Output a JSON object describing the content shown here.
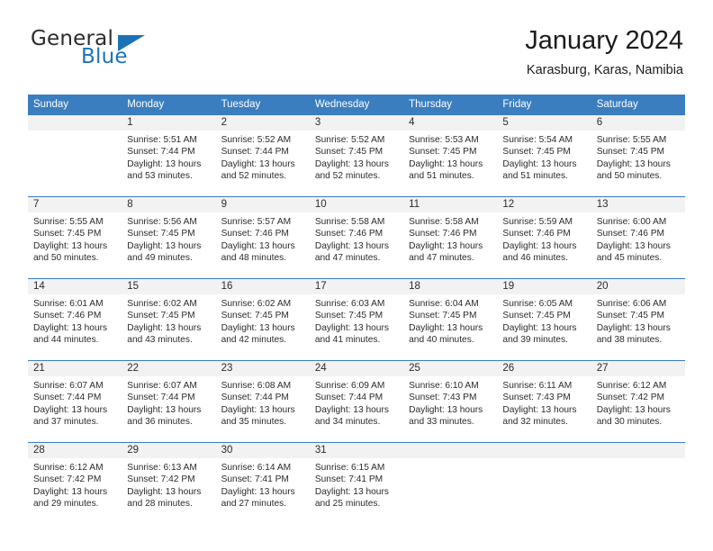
{
  "brand": {
    "name_part1": "General",
    "name_part2": "Blue",
    "triangle_color": "#1b72b8"
  },
  "header": {
    "title": "January 2024",
    "subtitle": "Karasburg, Karas, Namibia"
  },
  "theme": {
    "header_row_bg": "#3a7ebf",
    "daynum_bg": "#f2f2f2",
    "text": "#2b2b2b"
  },
  "weekday_headers": [
    "Sunday",
    "Monday",
    "Tuesday",
    "Wednesday",
    "Thursday",
    "Friday",
    "Saturday"
  ],
  "weeks": [
    [
      {
        "day": "",
        "sunrise": "",
        "sunset": "",
        "daylight_l1": "",
        "daylight_l2": ""
      },
      {
        "day": "1",
        "sunrise": "Sunrise: 5:51 AM",
        "sunset": "Sunset: 7:44 PM",
        "daylight_l1": "Daylight: 13 hours",
        "daylight_l2": "and 53 minutes."
      },
      {
        "day": "2",
        "sunrise": "Sunrise: 5:52 AM",
        "sunset": "Sunset: 7:44 PM",
        "daylight_l1": "Daylight: 13 hours",
        "daylight_l2": "and 52 minutes."
      },
      {
        "day": "3",
        "sunrise": "Sunrise: 5:52 AM",
        "sunset": "Sunset: 7:45 PM",
        "daylight_l1": "Daylight: 13 hours",
        "daylight_l2": "and 52 minutes."
      },
      {
        "day": "4",
        "sunrise": "Sunrise: 5:53 AM",
        "sunset": "Sunset: 7:45 PM",
        "daylight_l1": "Daylight: 13 hours",
        "daylight_l2": "and 51 minutes."
      },
      {
        "day": "5",
        "sunrise": "Sunrise: 5:54 AM",
        "sunset": "Sunset: 7:45 PM",
        "daylight_l1": "Daylight: 13 hours",
        "daylight_l2": "and 51 minutes."
      },
      {
        "day": "6",
        "sunrise": "Sunrise: 5:55 AM",
        "sunset": "Sunset: 7:45 PM",
        "daylight_l1": "Daylight: 13 hours",
        "daylight_l2": "and 50 minutes."
      }
    ],
    [
      {
        "day": "7",
        "sunrise": "Sunrise: 5:55 AM",
        "sunset": "Sunset: 7:45 PM",
        "daylight_l1": "Daylight: 13 hours",
        "daylight_l2": "and 50 minutes."
      },
      {
        "day": "8",
        "sunrise": "Sunrise: 5:56 AM",
        "sunset": "Sunset: 7:45 PM",
        "daylight_l1": "Daylight: 13 hours",
        "daylight_l2": "and 49 minutes."
      },
      {
        "day": "9",
        "sunrise": "Sunrise: 5:57 AM",
        "sunset": "Sunset: 7:46 PM",
        "daylight_l1": "Daylight: 13 hours",
        "daylight_l2": "and 48 minutes."
      },
      {
        "day": "10",
        "sunrise": "Sunrise: 5:58 AM",
        "sunset": "Sunset: 7:46 PM",
        "daylight_l1": "Daylight: 13 hours",
        "daylight_l2": "and 47 minutes."
      },
      {
        "day": "11",
        "sunrise": "Sunrise: 5:58 AM",
        "sunset": "Sunset: 7:46 PM",
        "daylight_l1": "Daylight: 13 hours",
        "daylight_l2": "and 47 minutes."
      },
      {
        "day": "12",
        "sunrise": "Sunrise: 5:59 AM",
        "sunset": "Sunset: 7:46 PM",
        "daylight_l1": "Daylight: 13 hours",
        "daylight_l2": "and 46 minutes."
      },
      {
        "day": "13",
        "sunrise": "Sunrise: 6:00 AM",
        "sunset": "Sunset: 7:46 PM",
        "daylight_l1": "Daylight: 13 hours",
        "daylight_l2": "and 45 minutes."
      }
    ],
    [
      {
        "day": "14",
        "sunrise": "Sunrise: 6:01 AM",
        "sunset": "Sunset: 7:46 PM",
        "daylight_l1": "Daylight: 13 hours",
        "daylight_l2": "and 44 minutes."
      },
      {
        "day": "15",
        "sunrise": "Sunrise: 6:02 AM",
        "sunset": "Sunset: 7:45 PM",
        "daylight_l1": "Daylight: 13 hours",
        "daylight_l2": "and 43 minutes."
      },
      {
        "day": "16",
        "sunrise": "Sunrise: 6:02 AM",
        "sunset": "Sunset: 7:45 PM",
        "daylight_l1": "Daylight: 13 hours",
        "daylight_l2": "and 42 minutes."
      },
      {
        "day": "17",
        "sunrise": "Sunrise: 6:03 AM",
        "sunset": "Sunset: 7:45 PM",
        "daylight_l1": "Daylight: 13 hours",
        "daylight_l2": "and 41 minutes."
      },
      {
        "day": "18",
        "sunrise": "Sunrise: 6:04 AM",
        "sunset": "Sunset: 7:45 PM",
        "daylight_l1": "Daylight: 13 hours",
        "daylight_l2": "and 40 minutes."
      },
      {
        "day": "19",
        "sunrise": "Sunrise: 6:05 AM",
        "sunset": "Sunset: 7:45 PM",
        "daylight_l1": "Daylight: 13 hours",
        "daylight_l2": "and 39 minutes."
      },
      {
        "day": "20",
        "sunrise": "Sunrise: 6:06 AM",
        "sunset": "Sunset: 7:45 PM",
        "daylight_l1": "Daylight: 13 hours",
        "daylight_l2": "and 38 minutes."
      }
    ],
    [
      {
        "day": "21",
        "sunrise": "Sunrise: 6:07 AM",
        "sunset": "Sunset: 7:44 PM",
        "daylight_l1": "Daylight: 13 hours",
        "daylight_l2": "and 37 minutes."
      },
      {
        "day": "22",
        "sunrise": "Sunrise: 6:07 AM",
        "sunset": "Sunset: 7:44 PM",
        "daylight_l1": "Daylight: 13 hours",
        "daylight_l2": "and 36 minutes."
      },
      {
        "day": "23",
        "sunrise": "Sunrise: 6:08 AM",
        "sunset": "Sunset: 7:44 PM",
        "daylight_l1": "Daylight: 13 hours",
        "daylight_l2": "and 35 minutes."
      },
      {
        "day": "24",
        "sunrise": "Sunrise: 6:09 AM",
        "sunset": "Sunset: 7:44 PM",
        "daylight_l1": "Daylight: 13 hours",
        "daylight_l2": "and 34 minutes."
      },
      {
        "day": "25",
        "sunrise": "Sunrise: 6:10 AM",
        "sunset": "Sunset: 7:43 PM",
        "daylight_l1": "Daylight: 13 hours",
        "daylight_l2": "and 33 minutes."
      },
      {
        "day": "26",
        "sunrise": "Sunrise: 6:11 AM",
        "sunset": "Sunset: 7:43 PM",
        "daylight_l1": "Daylight: 13 hours",
        "daylight_l2": "and 32 minutes."
      },
      {
        "day": "27",
        "sunrise": "Sunrise: 6:12 AM",
        "sunset": "Sunset: 7:42 PM",
        "daylight_l1": "Daylight: 13 hours",
        "daylight_l2": "and 30 minutes."
      }
    ],
    [
      {
        "day": "28",
        "sunrise": "Sunrise: 6:12 AM",
        "sunset": "Sunset: 7:42 PM",
        "daylight_l1": "Daylight: 13 hours",
        "daylight_l2": "and 29 minutes."
      },
      {
        "day": "29",
        "sunrise": "Sunrise: 6:13 AM",
        "sunset": "Sunset: 7:42 PM",
        "daylight_l1": "Daylight: 13 hours",
        "daylight_l2": "and 28 minutes."
      },
      {
        "day": "30",
        "sunrise": "Sunrise: 6:14 AM",
        "sunset": "Sunset: 7:41 PM",
        "daylight_l1": "Daylight: 13 hours",
        "daylight_l2": "and 27 minutes."
      },
      {
        "day": "31",
        "sunrise": "Sunrise: 6:15 AM",
        "sunset": "Sunset: 7:41 PM",
        "daylight_l1": "Daylight: 13 hours",
        "daylight_l2": "and 25 minutes."
      },
      {
        "day": "",
        "sunrise": "",
        "sunset": "",
        "daylight_l1": "",
        "daylight_l2": ""
      },
      {
        "day": "",
        "sunrise": "",
        "sunset": "",
        "daylight_l1": "",
        "daylight_l2": ""
      },
      {
        "day": "",
        "sunrise": "",
        "sunset": "",
        "daylight_l1": "",
        "daylight_l2": ""
      }
    ]
  ]
}
